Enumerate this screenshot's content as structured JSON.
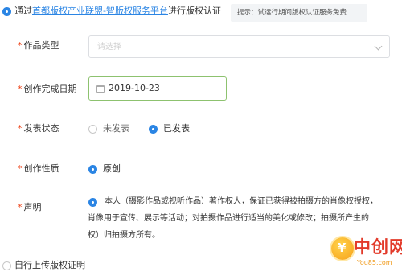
{
  "header": {
    "option_prefix": "通过",
    "option_link": "首都版权产业联盟-智版权服务平台",
    "option_suffix": "进行版权认证",
    "tip": "提示：试运行期间版权认证服务免费"
  },
  "form": {
    "work_type": {
      "label": "作品类型",
      "placeholder": "请选择"
    },
    "completion_date": {
      "label": "创作完成日期",
      "value": "2019-10-23"
    },
    "publish_status": {
      "label": "发表状态",
      "options": [
        "未发表",
        "已发表"
      ],
      "selected": "已发表"
    },
    "creation_nature": {
      "label": "创作性质",
      "option": "原创"
    },
    "statement": {
      "label": "声明",
      "lines": [
        "本人（摄影作品或视听作品）著作权人，保证已获得被拍摄方的肖像权授权，",
        "肖像用于宣传、展示等活动；对拍摄作品进行适当的美化或修改；拍摄所产生的",
        "权）归拍摄方所有。"
      ]
    }
  },
  "footer": {
    "self_upload": "自行上传版权证明"
  },
  "watermark": {
    "name": "中创网",
    "url": "You85.com"
  },
  "colors": {
    "accent": "#2b85e4",
    "required": "#ed4014",
    "date_border": "#8dc26f"
  }
}
